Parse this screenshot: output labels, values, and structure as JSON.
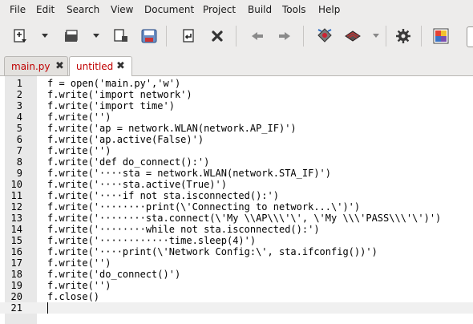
{
  "menu": [
    "File",
    "Edit",
    "Search",
    "View",
    "Document",
    "Project",
    "Build",
    "Tools",
    "Help"
  ],
  "toolbar": {
    "buttons": [
      "new-file-icon",
      "open-file-icon",
      "save-all-icon",
      "save-icon",
      "revert-icon",
      "close-icon",
      "navigate-back-icon",
      "navigate-forward-icon",
      "compile-icon",
      "build-icon",
      "preferences-icon",
      "color-chooser-icon"
    ]
  },
  "tabs": [
    {
      "label": "main.py",
      "close": "✖"
    },
    {
      "label": "untitled",
      "close": "✖"
    }
  ],
  "editor": {
    "lines": [
      {
        "num": "1",
        "text": "f = open('main.py','w')"
      },
      {
        "num": "2",
        "text": "f.write('import network')"
      },
      {
        "num": "3",
        "text": "f.write('import time')"
      },
      {
        "num": "4",
        "text": "f.write('')"
      },
      {
        "num": "5",
        "text": "f.write('ap = network.WLAN(network.AP_IF)')"
      },
      {
        "num": "6",
        "text": "f.write('ap.active(False)')"
      },
      {
        "num": "7",
        "text": "f.write('')"
      },
      {
        "num": "8",
        "text": "f.write('def do_connect():')"
      },
      {
        "num": "9",
        "text": "f.write('····sta = network.WLAN(network.STA_IF)')"
      },
      {
        "num": "10",
        "text": "f.write('····sta.active(True)')"
      },
      {
        "num": "11",
        "text": "f.write('····if not sta.isconnected():')"
      },
      {
        "num": "12",
        "text": "f.write('········print(\\'Connecting to network...\\')')"
      },
      {
        "num": "13",
        "text": "f.write('········sta.connect(\\'My \\\\AP\\\\\\'\\', \\'My \\\\\\'PASS\\\\\\'\\')')"
      },
      {
        "num": "14",
        "text": "f.write('········while not sta.isconnected():')"
      },
      {
        "num": "15",
        "text": "f.write('············time.sleep(4)')"
      },
      {
        "num": "16",
        "text": "f.write('····print(\\'Network Config:\\', sta.ifconfig())')"
      },
      {
        "num": "17",
        "text": "f.write('')"
      },
      {
        "num": "18",
        "text": "f.write('do_connect()')"
      },
      {
        "num": "19",
        "text": "f.write('')"
      },
      {
        "num": "20",
        "text": "f.close()"
      },
      {
        "num": "21",
        "text": ""
      }
    ]
  }
}
